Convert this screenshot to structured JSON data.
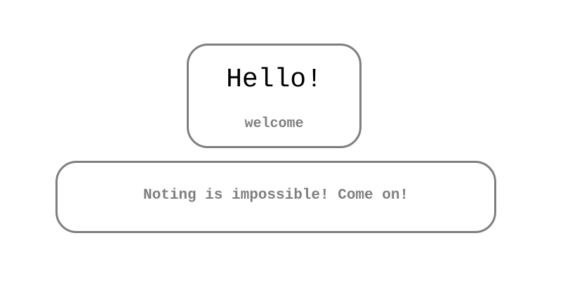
{
  "greeting": {
    "title": "Hello!",
    "subtitle": "welcome"
  },
  "motto": {
    "text": "Noting is impossible! Come on!"
  },
  "colors": {
    "border": "#7f7f7f",
    "title_text": "#000000",
    "secondary_text": "#7f7f7f",
    "background": "#ffffff"
  }
}
